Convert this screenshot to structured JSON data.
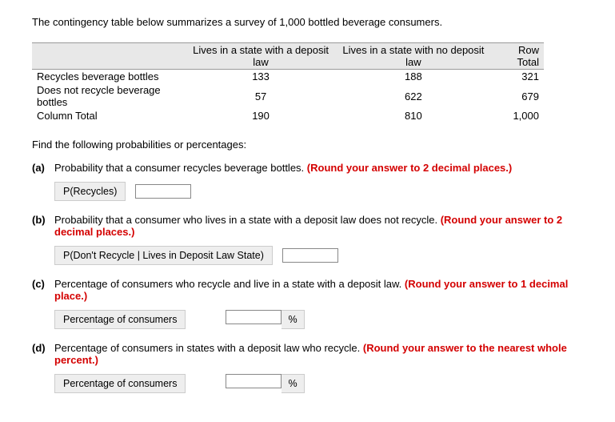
{
  "intro": "The contingency table below summarizes a survey of 1,000 bottled beverage consumers.",
  "table": {
    "col1": "Lives in a state with a deposit law",
    "col2": "Lives in a state with no deposit law",
    "col3": "Row Total",
    "rows": [
      {
        "label": "Recycles beverage bottles",
        "c1": "133",
        "c2": "188",
        "c3": "321",
        "indent": false
      },
      {
        "label": "Does not recycle beverage bottles",
        "c1": "57",
        "c2": "622",
        "c3": "679",
        "indent": false
      },
      {
        "label": "Column Total",
        "c1": "190",
        "c2": "810",
        "c3": "1,000",
        "indent": true
      }
    ]
  },
  "prompt": "Find the following probabilities or percentages:",
  "parts": {
    "a": {
      "marker": "(a)",
      "text": "Probability that a consumer recycles beverage bottles. ",
      "red": "(Round your answer to 2 decimal places.)",
      "label": "P(Recycles)"
    },
    "b": {
      "marker": "(b)",
      "text": "Probability that a consumer who lives in a state with a deposit law does not recycle. ",
      "red": "(Round your answer to 2 decimal places.)",
      "label": "P(Don't Recycle | Lives in Deposit Law State)"
    },
    "c": {
      "marker": "(c)",
      "text": "Percentage of consumers who recycle and live in a state with a deposit law. ",
      "red": "(Round your answer to 1 decimal place.)",
      "label": "Percentage of consumers",
      "unit": "%"
    },
    "d": {
      "marker": "(d)",
      "text": "Percentage of consumers in states with a deposit law who recycle. ",
      "red": "(Round your answer to the nearest whole percent.)",
      "label": "Percentage of consumers",
      "unit": "%"
    }
  }
}
